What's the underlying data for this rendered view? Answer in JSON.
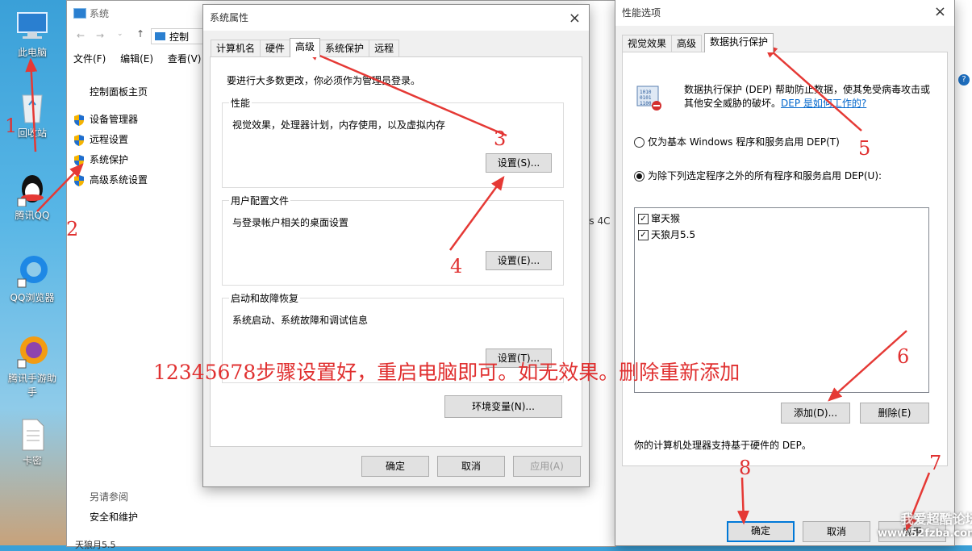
{
  "desktop": {
    "icons": [
      {
        "label": "此电脑"
      },
      {
        "label": "回收站"
      },
      {
        "label": "腾讯QQ"
      },
      {
        "label": "QQ浏览器"
      },
      {
        "label": "腾讯手游助手"
      },
      {
        "label": "卡密"
      }
    ]
  },
  "system_window": {
    "title": "系统",
    "address": "控制",
    "menu": [
      "文件(F)",
      "编辑(E)",
      "查看(V)"
    ],
    "home_link": "控制面板主页",
    "links": [
      "设备管理器",
      "远程设置",
      "系统保护",
      "高级系统设置"
    ],
    "see_also": "另请参阅",
    "see_also_link": "安全和维护",
    "bottom_text": "天狼月5.5",
    "fragment": "es 4C"
  },
  "sys_props": {
    "title": "系统属性",
    "tabs": [
      "计算机名",
      "硬件",
      "高级",
      "系统保护",
      "远程"
    ],
    "admin_note": "要进行大多数更改，你必须作为管理员登录。",
    "performance": {
      "label": "性能",
      "desc": "视觉效果，处理器计划，内存使用，以及虚拟内存",
      "button": "设置(S)..."
    },
    "profiles": {
      "label": "用户配置文件",
      "desc": "与登录帐户相关的桌面设置",
      "button": "设置(E)..."
    },
    "startup": {
      "label": "启动和故障恢复",
      "desc": "系统启动、系统故障和调试信息",
      "button": "设置(T)..."
    },
    "env_button": "环境变量(N)...",
    "ok": "确定",
    "cancel": "取消",
    "apply": "应用(A)"
  },
  "perf_opts": {
    "title": "性能选项",
    "tabs": [
      "视觉效果",
      "高级",
      "数据执行保护"
    ],
    "dep_desc_1": "数据执行保护 (DEP) 帮助防止数据，使其免受病毒攻击或",
    "dep_desc_2": "其他安全威胁的破坏。",
    "dep_link": "DEP 是如何工作的?",
    "radio1": "仅为基本 Windows 程序和服务启用 DEP(T)",
    "radio2": "为除下列选定程序之外的所有程序和服务启用 DEP(U):",
    "programs": [
      "窜天猴",
      "天狼月5.5"
    ],
    "add_button": "添加(D)...",
    "remove_button": "删除(E)",
    "support_note": "你的计算机处理器支持基于硬件的 DEP。",
    "ok": "确定",
    "cancel": "取消",
    "apply": "应用"
  },
  "annotations": {
    "numbers": [
      "1",
      "2",
      "3",
      "4",
      "5",
      "6",
      "7",
      "8"
    ],
    "instruction": "12345678步骤设置好，重启电脑即可。如无效果。删除重新添加",
    "arrow_color": "#e53935"
  },
  "watermark": {
    "line1": "我爱超酷论坛",
    "line2": "www.52fzba.com"
  }
}
